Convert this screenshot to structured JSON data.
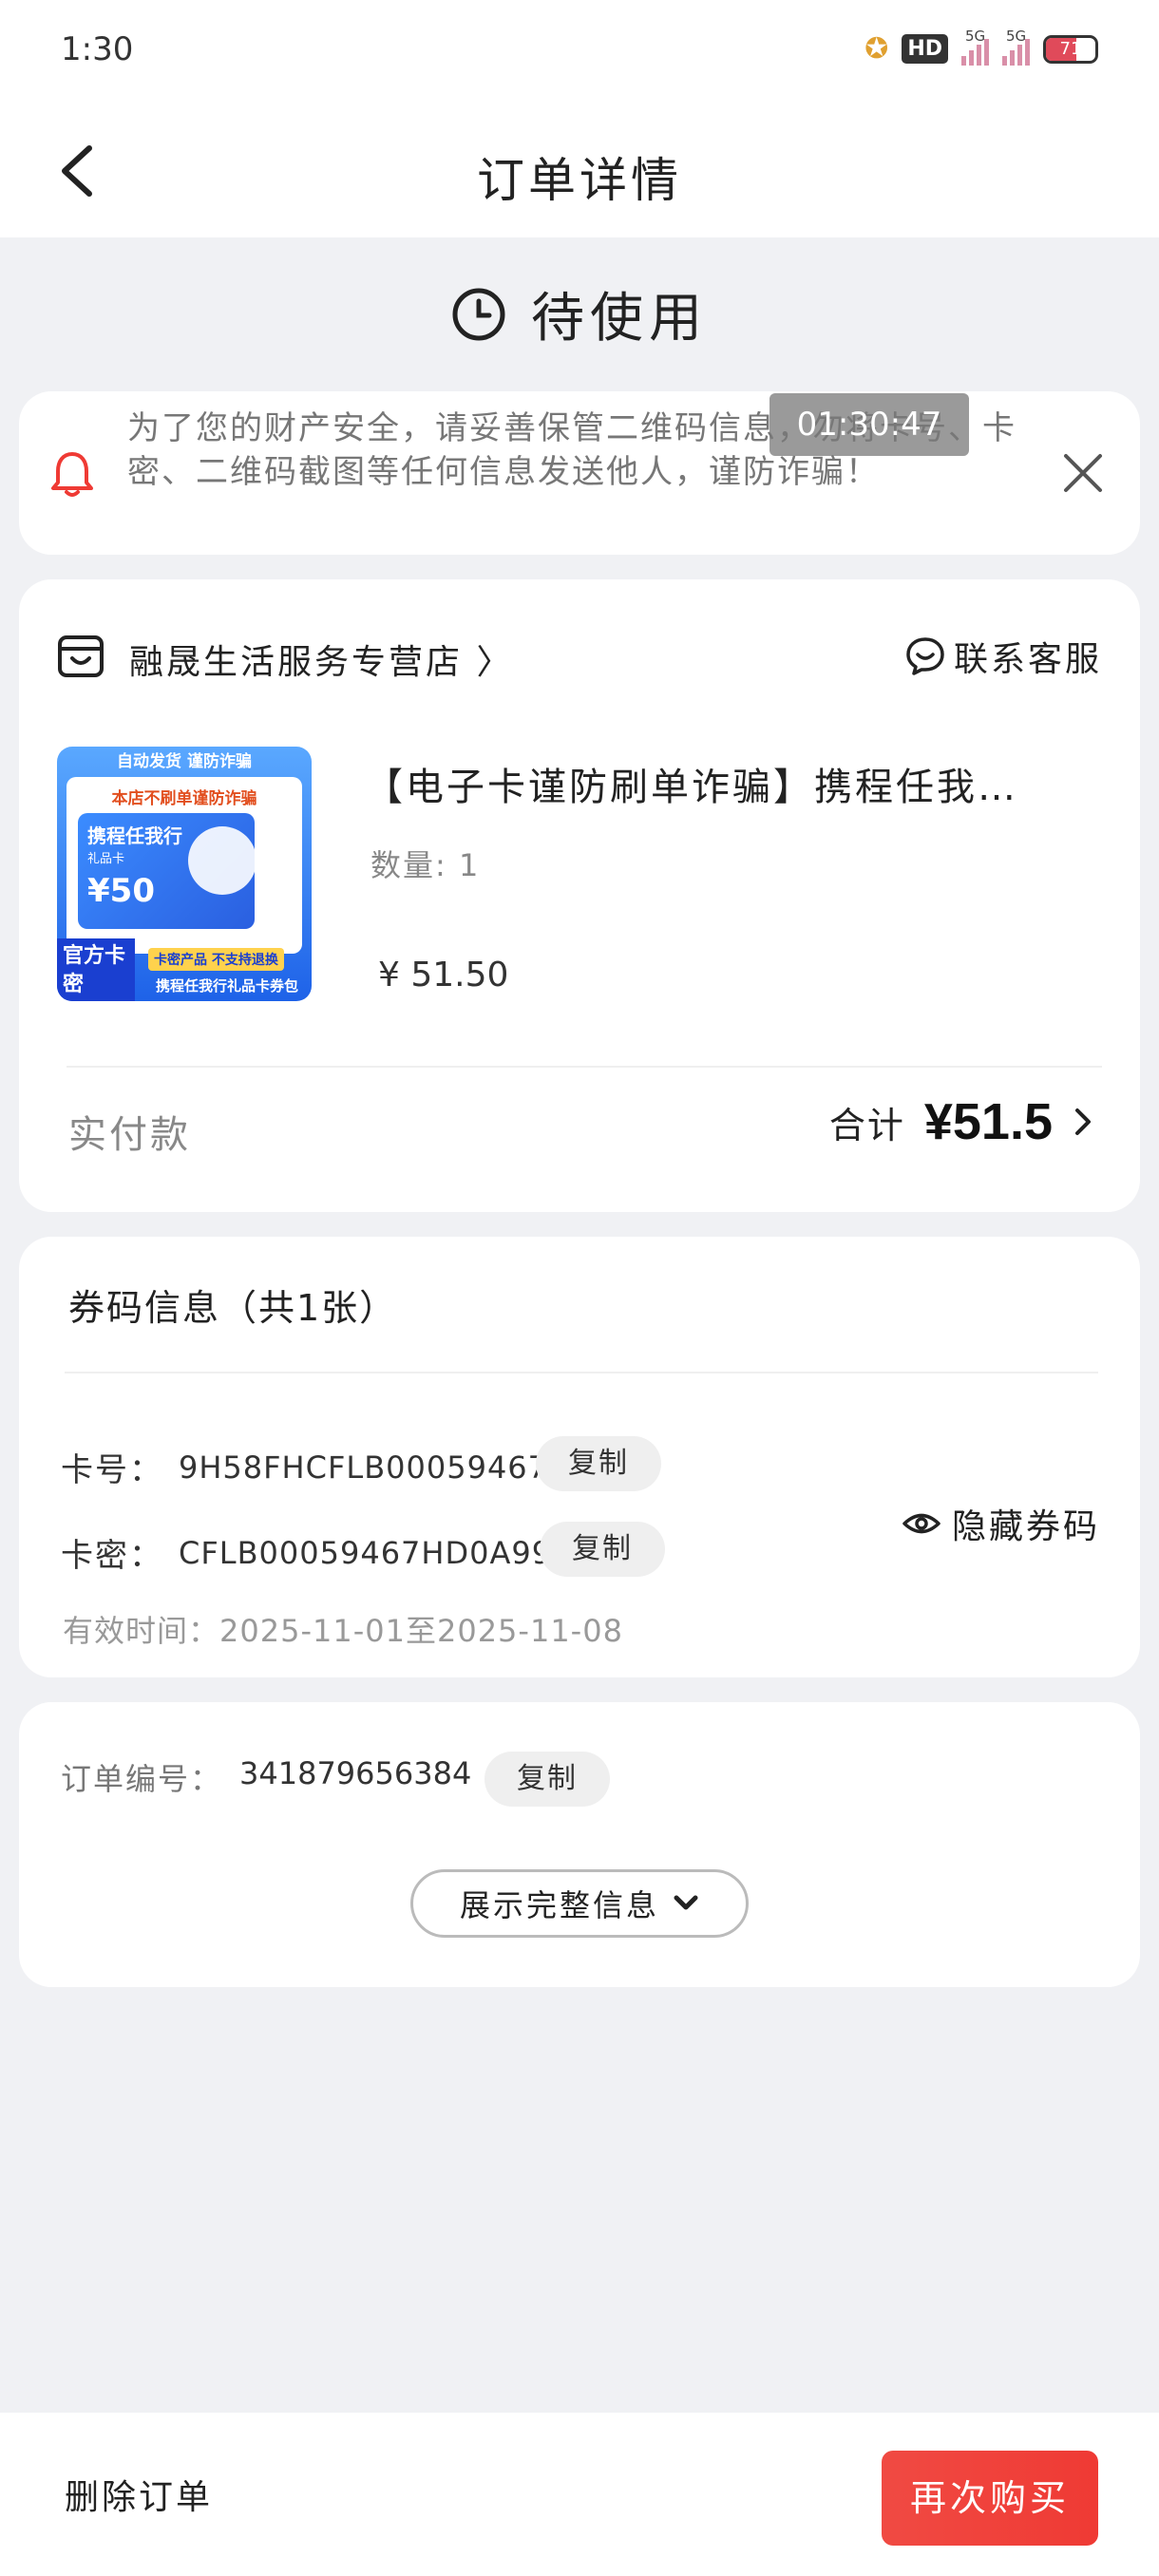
{
  "status_bar": {
    "time": "1:30",
    "hd_label": "HD",
    "network_1": "5G",
    "network_2": "5G",
    "battery": "71"
  },
  "header": {
    "title": "订单详情"
  },
  "order_status": {
    "label": "待使用"
  },
  "notice": {
    "message": "为了您的财产安全，请妥善保管二维码信息，勿将卡号、卡密、二维码截图等任何信息发送他人，谨防诈骗！",
    "timestamp_overlay": "01:30:47"
  },
  "product": {
    "shop_name": "融晟生活服务专营店 〉",
    "customer_service": "联系客服",
    "title": "【电子卡谨防刷单诈骗】携程任我…",
    "quantity": "数量: 1",
    "price": "¥  51.50",
    "thumbnail": {
      "top_text": "自动发货 谨防诈骗",
      "sub_text": "本店不刷单谨防诈骗",
      "card_title": "携程任我行",
      "card_sub": "礼品卡",
      "card_amount": "¥50",
      "badge": "官方卡密",
      "tag": "卡密产品  不支持退换",
      "footer": "携程任我行礼品卡券包"
    },
    "paid_label": "实付款",
    "total_label": "合计",
    "total_amount": "¥51.5"
  },
  "coupon": {
    "heading": "券码信息（共1张）",
    "card_no_label": "卡号：",
    "card_no": "9H58FHCFLB00059467",
    "card_pwd_label": "卡密：",
    "card_pwd": "CFLB00059467HD0A99",
    "copy_label": "复制",
    "validity": "有效时间：2025-11-01至2025-11-08",
    "hide_code": "隐藏券码"
  },
  "order": {
    "number_label": "订单编号：",
    "number": "341879656384",
    "copy_label": "复制",
    "expand_label": "展示完整信息"
  },
  "bottom": {
    "delete_label": "删除订单",
    "rebuy_label": "再次购买"
  },
  "colors": {
    "accent_red": "#ef3a34",
    "background": "#f0f1f4"
  }
}
